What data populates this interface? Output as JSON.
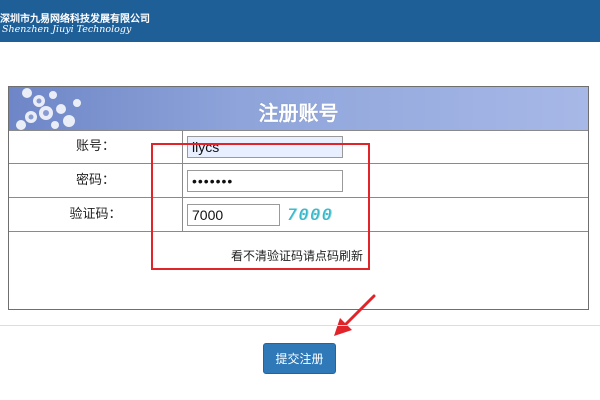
{
  "header": {
    "company_cn": "深圳市九易网络科技发展有限公司",
    "company_en": "Shenzhen Jiuyi Technology"
  },
  "form": {
    "title": "注册账号",
    "account": {
      "label": "账号：",
      "value": "llycs"
    },
    "password": {
      "label": "密码：",
      "value": "•••••••"
    },
    "captcha": {
      "label": "验证码：",
      "value": "7000",
      "image_text": "7000"
    },
    "refresh_hint": "看不清验证码请点码刷新",
    "submit_label": "提交注册"
  },
  "colors": {
    "header_bg": "#1f5f98",
    "title_bar": "#8ea4da",
    "highlight": "#e0242a",
    "button": "#2f79b9",
    "captcha_text": "#37b7c9"
  },
  "icons": {
    "decoration": "snowflake-decoration-icon",
    "annotation": "red-arrow-icon"
  }
}
